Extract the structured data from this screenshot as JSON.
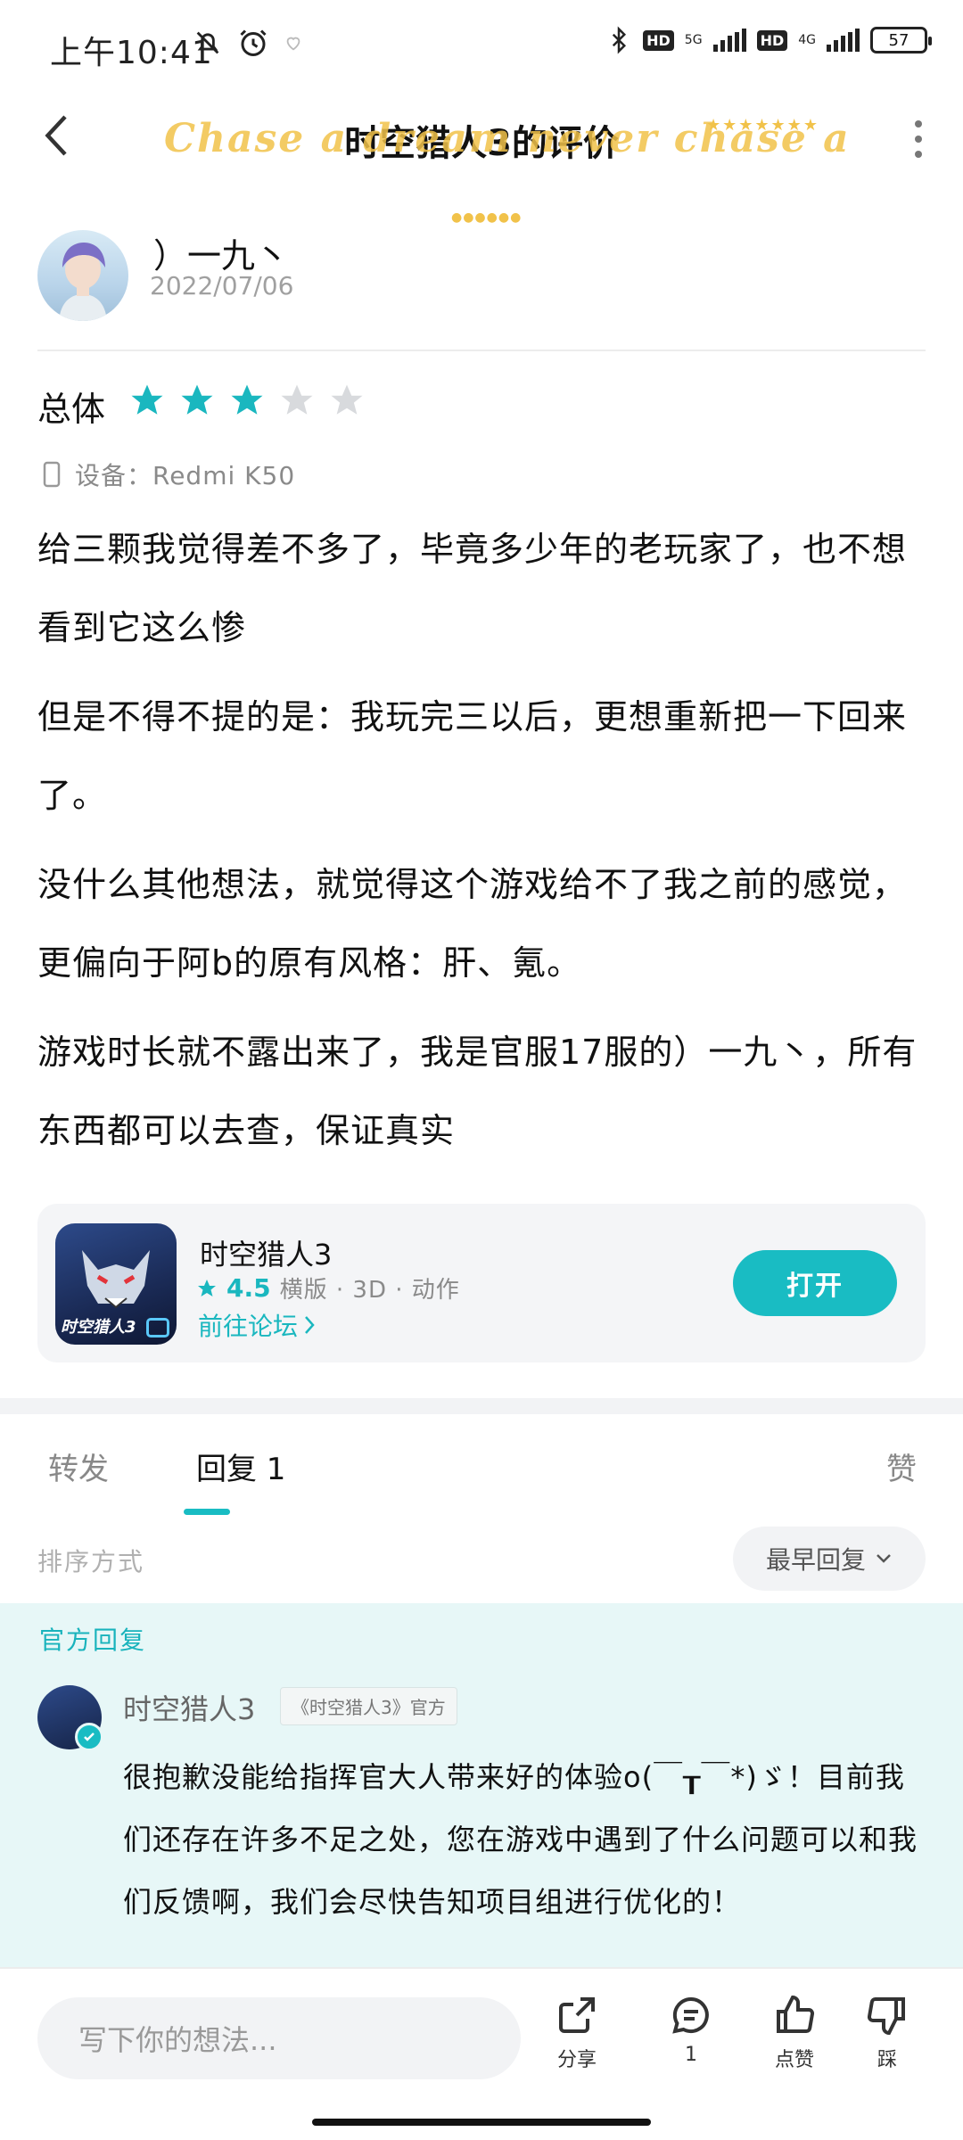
{
  "status_bar": {
    "time": "上午10:41",
    "net_left": "5G",
    "net_right": "4G",
    "hd_label": "HD",
    "battery": "57"
  },
  "header": {
    "title": "时空猎人3的评价",
    "overlay_text": "Chase a dream never chase a"
  },
  "review": {
    "author": "）一九丶",
    "date": "2022/07/06",
    "rating_label": "总体",
    "rating": 3,
    "rating_max": 5,
    "device": "设备：Redmi K50",
    "paragraphs": [
      "给三颗我觉得差不多了，毕竟多少年的老玩家了，也不想看到它这么惨",
      "但是不得不提的是：我玩完三以后，更想重新把一下回来了。",
      "没什么其他想法，就觉得这个游戏给不了我之前的感觉，更偏向于阿b的原有风格：肝、氪。",
      "游戏时长就不露出来了，我是官服17服的）一九丶，所有东西都可以去查，保证真实"
    ]
  },
  "app_card": {
    "icon_label": "时空猎人3",
    "name": "时空猎人3",
    "score": "4.5",
    "tags": "横版 · 3D · 动作",
    "forum_link": "前往论坛",
    "open_button": "打开"
  },
  "tabs": {
    "forward": "转发",
    "replies": "回复 1",
    "likes": "赞"
  },
  "sort": {
    "label": "排序方式",
    "selected": "最早回复"
  },
  "official_reply": {
    "section_label": "官方回复",
    "name": "时空猎人3",
    "tag": "《时空猎人3》官方",
    "text": "很抱歉没能给指挥官大人带来好的体验o(￣┰￣*)ゞ！目前我们还存在许多不足之处，您在游戏中遇到了什么问题可以和我们反馈啊，我们会尽快告知项目组进行优化的！"
  },
  "bottom_bar": {
    "input_placeholder": "写下你的想法...",
    "share_label": "分享",
    "comment_count": "1",
    "like_label": "点赞",
    "dislike_label": "踩"
  },
  "colors": {
    "accent": "#19bcc3",
    "star_active": "#1ab7bf",
    "star_inactive": "#d8dadd",
    "official_bg": "#e7f7f7"
  }
}
